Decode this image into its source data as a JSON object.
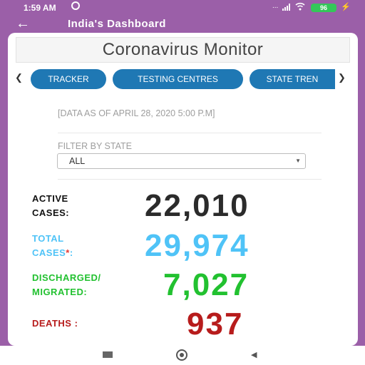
{
  "status_bar": {
    "time": "1:59 AM",
    "battery": "96",
    "icons": [
      "alarm-icon",
      "signal-icon",
      "wifi-icon",
      "battery-icon",
      "charging-icon"
    ]
  },
  "app_bar": {
    "title": "India's Dashboard",
    "back_icon": "back-arrow-icon"
  },
  "header": {
    "title": "Coronavirus Monitor"
  },
  "tabs": {
    "prev_icon": "chevron-left-icon",
    "next_icon": "chevron-right-icon",
    "items": [
      {
        "label": "TRACKER"
      },
      {
        "label": "TESTING CENTRES"
      },
      {
        "label": "STATE TRENDS",
        "visible_label": "STATE TREN"
      }
    ]
  },
  "data_note": "[DATA AS OF APRIL 28, 2020 5:00 P.M]",
  "filter": {
    "label": "FILTER BY STATE",
    "selected": "ALL"
  },
  "stats": {
    "active": {
      "label_line1": "ACTIVE",
      "label_line2": "CASES:",
      "value": "22,010",
      "color": "#2b2b2b"
    },
    "total": {
      "label_line1": "TOTAL",
      "label_line2": "CASES",
      "asterisk": "*",
      "colon": ":",
      "value": "29,974",
      "color": "#4fc3f7",
      "asterisk_color": "#e53935"
    },
    "discharged": {
      "label_line1": "DISCHARGED/",
      "label_line2": "MIGRATED:",
      "value": "7,027",
      "color": "#22c130"
    },
    "deaths": {
      "label": "DEATHS :",
      "value": "937",
      "color": "#b71c1c"
    }
  },
  "nav_bar": {
    "icons": [
      "recents-icon",
      "home-icon",
      "back-icon"
    ]
  },
  "colors": {
    "header_bg": "#9b5fa8",
    "pill_bg": "#1f78b4"
  }
}
